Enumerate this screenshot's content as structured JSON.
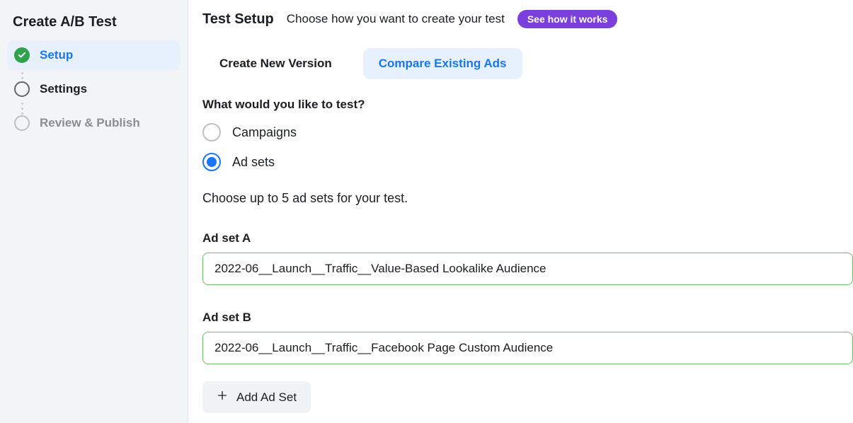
{
  "sidebar": {
    "title": "Create A/B Test",
    "steps": [
      {
        "label": "Setup"
      },
      {
        "label": "Settings"
      },
      {
        "label": "Review & Publish"
      }
    ]
  },
  "header": {
    "title": "Test Setup",
    "subtitle": "Choose how you want to create your test",
    "help_label": "See how it works"
  },
  "tabs": {
    "create_new": "Create New Version",
    "compare_existing": "Compare Existing Ads"
  },
  "form": {
    "question": "What would you like to test?",
    "options": {
      "campaigns": "Campaigns",
      "ad_sets": "Ad sets"
    },
    "hint": "Choose up to 5 ad sets for your test.",
    "adsets": [
      {
        "label": "Ad set A",
        "value": "2022-06__Launch__Traffic__Value-Based Lookalike Audience"
      },
      {
        "label": "Ad set B",
        "value": "2022-06__Launch__Traffic__Facebook Page Custom Audience"
      }
    ],
    "add_button": "Add Ad Set"
  }
}
